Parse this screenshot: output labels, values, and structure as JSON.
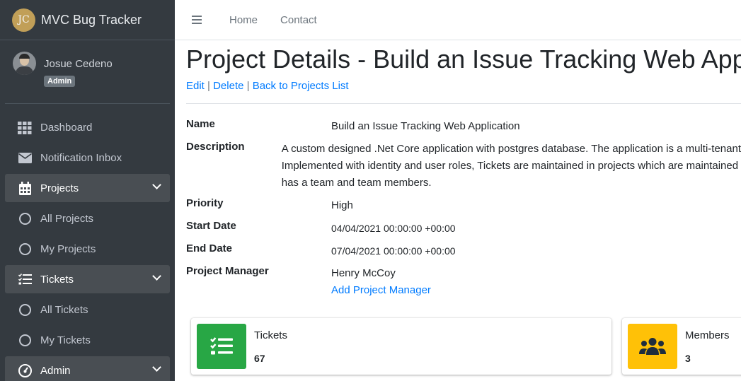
{
  "brand": {
    "logo_text": "JC",
    "name": "MVC Bug Tracker"
  },
  "user": {
    "name": "Josue Cedeno",
    "role": "Admin"
  },
  "sidebar": {
    "items": [
      {
        "label": "Dashboard",
        "icon": "grid-icon"
      },
      {
        "label": "Notification Inbox",
        "icon": "envelope-icon"
      },
      {
        "label": "Projects",
        "icon": "calendar-icon",
        "open": true
      },
      {
        "label": "All Projects",
        "icon": "circle-icon"
      },
      {
        "label": "My Projects",
        "icon": "circle-icon"
      },
      {
        "label": "Tickets",
        "icon": "tasks-icon",
        "open": true
      },
      {
        "label": "All Tickets",
        "icon": "circle-icon"
      },
      {
        "label": "My Tickets",
        "icon": "circle-icon"
      },
      {
        "label": "Admin",
        "icon": "gauge-icon",
        "open": true
      }
    ]
  },
  "topbar": {
    "home": "Home",
    "contact": "Contact"
  },
  "page": {
    "title": "Project Details - Build an Issue Tracking Web Application",
    "edit": "Edit",
    "delete": "Delete",
    "back": "Back to Projects List",
    "separator": " | "
  },
  "details": {
    "name_label": "Name",
    "name_value": "Build an Issue Tracking Web Application",
    "description_label": "Description",
    "description_line1": "A custom designed .Net Core application with postgres database. The application is a multi-tenant",
    "description_line2": "Implemented with identity and user roles, Tickets are maintained in projects which are maintained",
    "description_line3": "has a team and team members.",
    "priority_label": "Priority",
    "priority_value": "High",
    "start_label": "Start Date",
    "start_value": "04/04/2021 00:00:00 +00:00",
    "end_label": "End Date",
    "end_value": "07/04/2021 00:00:00 +00:00",
    "manager_label": "Project Manager",
    "manager_value": "Henry McCoy",
    "add_manager": "Add Project Manager"
  },
  "cards": {
    "tickets": {
      "label": "Tickets",
      "value": "67",
      "color": "#28a745",
      "icon": "tasks-icon"
    },
    "members": {
      "label": "Members",
      "value": "3",
      "color": "#ffc107",
      "icon": "users-icon"
    }
  },
  "colors": {
    "sidebar_bg": "#343a40",
    "link": "#007bff"
  }
}
